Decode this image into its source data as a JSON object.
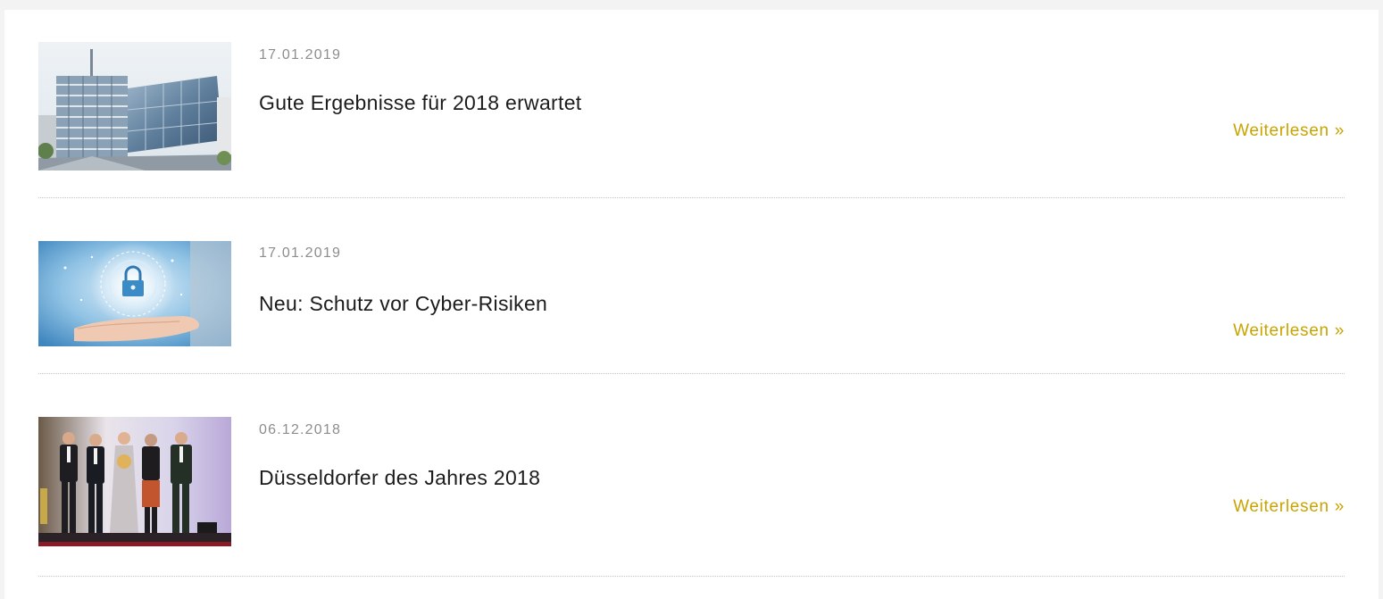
{
  "news": {
    "items": [
      {
        "date": "17.01.2019",
        "title": "Gute Ergebnisse für 2018 erwartet",
        "more_label": "Weiterlesen »",
        "image": "office-building-photo"
      },
      {
        "date": "17.01.2019",
        "title": "Neu: Schutz vor Cyber-Risiken",
        "more_label": "Weiterlesen »",
        "image": "cyber-security-lock-photo"
      },
      {
        "date": "06.12.2018",
        "title": "Düsseldorfer des Jahres 2018",
        "more_label": "Weiterlesen »",
        "image": "award-ceremony-photo"
      }
    ]
  },
  "colors": {
    "page_background": "#f4f3f4",
    "card_background": "#ffffff",
    "date_text": "#8d8d8d",
    "title_text": "#1c1c1c",
    "link_accent": "#c9a400",
    "divider": "#c4c4c4"
  }
}
